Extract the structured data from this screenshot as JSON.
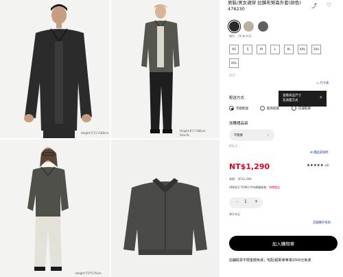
{
  "images": {
    "img1": {
      "caption": "Height:5'11\"/180cm"
    },
    "img2": {
      "caption_line1": "Height:6'1\"/186cm",
      "caption_line2": "Size:XL"
    },
    "img3": {
      "caption": "Height:5'9\"/176cm"
    }
  },
  "product": {
    "title": "男裝/男女適穿 拉鍊布勞森外套(拼色) 478230",
    "colors": [
      {
        "hex": "#2a2a2a",
        "selected": true
      },
      {
        "hex": "#b7b19e",
        "selected": false
      },
      {
        "hex": "#5f605c",
        "selected": false
      }
    ],
    "color_label": "顏色： 09 BLACK",
    "sizes": [
      "XS",
      "S",
      "M",
      "L",
      "XL",
      "XXL",
      "3XL",
      "4XL"
    ],
    "size_label": "尺寸：",
    "size_guide": "尺寸表",
    "tooltip_line1": "查看商品尺寸",
    "tooltip_line2": "及測量方式",
    "tooltip_close": "×",
    "delivery_title": "配送方式",
    "delivery_options": [
      "宅配配送",
      "超商取貨",
      "店舖取貨"
    ],
    "gift_title": "加購禮品袋",
    "gift_select_value": "不需要",
    "gift_price_note": "NT$ 0",
    "info_link": "禮品袋說明",
    "price": "NT$1,290",
    "rating_stars": "★★★★★",
    "rating_count": "(8)",
    "original_price": "原價： NT$1,990",
    "store_note_prefix": "UNIQLO TAIPEI 門市期間販售：",
    "store_note_em": "特價商品",
    "qty_minus": "−",
    "qty_value": "1",
    "qty_plus": "+",
    "stock_note": "庫存充足",
    "store_stock_link": "店舖庫存查詢",
    "add_to_cart": "加入購物車",
    "bottom_note": "店舖取貨不限金額免運；宅配/超取單筆滿1500元免運"
  },
  "icons": {
    "share": "⤴",
    "wishlist": "♡",
    "ruler": "▭",
    "chevron": "⌄",
    "gift": "⊞"
  }
}
